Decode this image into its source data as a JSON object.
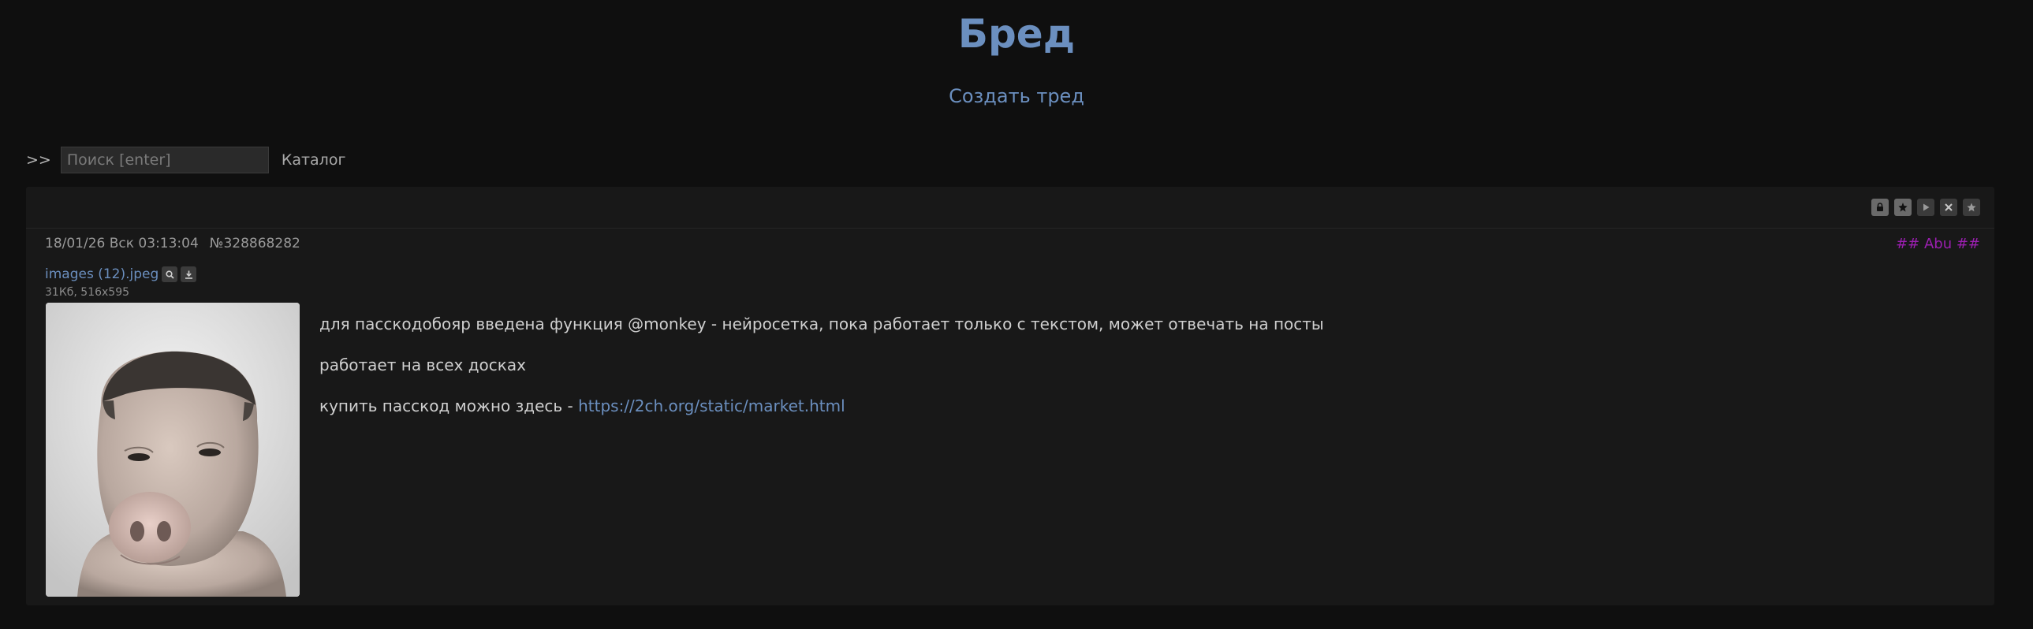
{
  "board": {
    "title": "Бред",
    "create_thread": "Создать тред"
  },
  "toolbar": {
    "arrows": ">>",
    "search_placeholder": "Поиск [enter]",
    "catalog": "Каталог"
  },
  "thread": {
    "buttons": [
      "lock-icon",
      "pin-icon",
      "play-icon",
      "close-icon",
      "star-icon"
    ],
    "post": {
      "date": "18/01/26 Вск 03:13:04",
      "number": "№328868282",
      "author": "## Abu ##",
      "file": {
        "name": "images (12).jpeg",
        "size": "31Кб, 516x595"
      },
      "body": {
        "line1": "для пасскодобояр введена функция @monkey - нейросетка, пока работает только с текстом, может отвечать на посты",
        "line2": "работает на всех досках",
        "line3_prefix": "купить пасскод можно здесь - ",
        "link": "https://2ch.org/static/market.html"
      }
    }
  },
  "colors": {
    "accent": "#6b8fbf",
    "author": "#9b1fb0",
    "background": "#0f0f0f",
    "post_bg": "#181818"
  }
}
